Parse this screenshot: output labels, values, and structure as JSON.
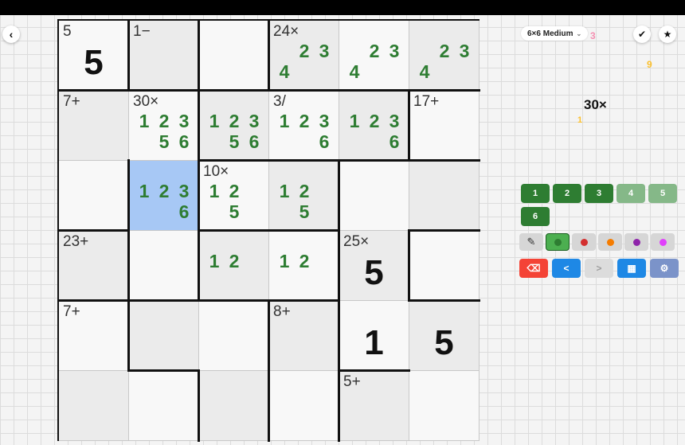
{
  "header": {
    "back_icon": "chevron-left-icon",
    "back_glyph": "‹",
    "difficulty": "6×6 Medium",
    "dropdown_glyph": "⌄",
    "check_glyph": "✔",
    "star_glyph": "★"
  },
  "floating_digits": [
    "3",
    "9",
    "1"
  ],
  "cage_hint": "30×",
  "board": {
    "cells": [
      {
        "cage": "5",
        "value": "5",
        "notes": [],
        "bg": "white"
      },
      {
        "cage": "1−",
        "value": "",
        "notes": [],
        "bg": "shade"
      },
      {
        "cage": "",
        "value": "",
        "notes": [],
        "bg": "white"
      },
      {
        "cage": "24×",
        "value": "",
        "notes": [
          "",
          "2",
          "3",
          "4",
          "",
          ""
        ],
        "bg": "shade"
      },
      {
        "cage": "",
        "value": "",
        "notes": [
          "",
          "2",
          "3",
          "4",
          "",
          ""
        ],
        "bg": "white"
      },
      {
        "cage": "",
        "value": "",
        "notes": [
          "",
          "2",
          "3",
          "4",
          "",
          ""
        ],
        "bg": "shade"
      },
      {
        "cage": "7+",
        "value": "",
        "notes": [],
        "bg": "shade"
      },
      {
        "cage": "30×",
        "value": "",
        "notes": [
          "1",
          "2",
          "3",
          "",
          "5",
          "6"
        ],
        "bg": "white"
      },
      {
        "cage": "",
        "value": "",
        "notes": [
          "1",
          "2",
          "3",
          "",
          "5",
          "6"
        ],
        "bg": "shade"
      },
      {
        "cage": "3/",
        "value": "",
        "notes": [
          "1",
          "2",
          "3",
          "",
          "",
          "6"
        ],
        "bg": "white"
      },
      {
        "cage": "",
        "value": "",
        "notes": [
          "1",
          "2",
          "3",
          "",
          "",
          "6"
        ],
        "bg": "shade"
      },
      {
        "cage": "17+",
        "value": "",
        "notes": [],
        "bg": "white"
      },
      {
        "cage": "",
        "value": "",
        "notes": [],
        "bg": "white"
      },
      {
        "cage": "",
        "value": "",
        "notes": [
          "1",
          "2",
          "3",
          "",
          "",
          "6"
        ],
        "bg": "sel"
      },
      {
        "cage": "10×",
        "value": "",
        "notes": [
          "1",
          "2",
          "",
          "",
          "5",
          ""
        ],
        "bg": "white"
      },
      {
        "cage": "",
        "value": "",
        "notes": [
          "1",
          "2",
          "",
          "",
          "5",
          ""
        ],
        "bg": "shade"
      },
      {
        "cage": "",
        "value": "",
        "notes": [],
        "bg": "white"
      },
      {
        "cage": "",
        "value": "",
        "notes": [],
        "bg": "shade"
      },
      {
        "cage": "23+",
        "value": "",
        "notes": [],
        "bg": "shade"
      },
      {
        "cage": "",
        "value": "",
        "notes": [],
        "bg": "white"
      },
      {
        "cage": "",
        "value": "",
        "notes": [
          "1",
          "2",
          "",
          "",
          "",
          ""
        ],
        "bg": "shade"
      },
      {
        "cage": "",
        "value": "",
        "notes": [
          "1",
          "2",
          "",
          "",
          "",
          ""
        ],
        "bg": "white"
      },
      {
        "cage": "25×",
        "value": "5",
        "notes": [],
        "bg": "shade"
      },
      {
        "cage": "",
        "value": "",
        "notes": [],
        "bg": "white"
      },
      {
        "cage": "7+",
        "value": "",
        "notes": [],
        "bg": "white"
      },
      {
        "cage": "",
        "value": "",
        "notes": [],
        "bg": "shade"
      },
      {
        "cage": "",
        "value": "",
        "notes": [],
        "bg": "white"
      },
      {
        "cage": "8+",
        "value": "",
        "notes": [],
        "bg": "shade"
      },
      {
        "cage": "",
        "value": "1",
        "notes": [],
        "bg": "white"
      },
      {
        "cage": "",
        "value": "5",
        "notes": [],
        "bg": "shade"
      },
      {
        "cage": "",
        "value": "",
        "notes": [],
        "bg": "shade"
      },
      {
        "cage": "",
        "value": "",
        "notes": [],
        "bg": "white"
      },
      {
        "cage": "",
        "value": "",
        "notes": [],
        "bg": "shade"
      },
      {
        "cage": "",
        "value": "",
        "notes": [],
        "bg": "white"
      },
      {
        "cage": "5+",
        "value": "",
        "notes": [],
        "bg": "shade"
      },
      {
        "cage": "",
        "value": "",
        "notes": [],
        "bg": "white"
      }
    ]
  },
  "number_pad": [
    {
      "label": "1",
      "enabled": true
    },
    {
      "label": "2",
      "enabled": true
    },
    {
      "label": "3",
      "enabled": true
    },
    {
      "label": "4",
      "enabled": false
    },
    {
      "label": "5",
      "enabled": false
    },
    {
      "label": "6",
      "enabled": true
    }
  ],
  "tools": [
    {
      "name": "pencil-icon",
      "glyph": "✎"
    },
    {
      "name": "green-color-dot",
      "color": "#2e7d32"
    },
    {
      "name": "red-color-dot",
      "color": "#d32f2f"
    },
    {
      "name": "orange-color-dot",
      "color": "#f57c00"
    },
    {
      "name": "purple-color-dot",
      "color": "#8e24aa"
    },
    {
      "name": "pink-color-dot",
      "color": "#e040fb"
    }
  ],
  "actions": [
    {
      "name": "erase-button",
      "glyph": "⌫",
      "bg": "#f44336",
      "color": "#ffffff"
    },
    {
      "name": "undo-button",
      "glyph": "<",
      "bg": "#1e88e5",
      "color": "#ffffff"
    },
    {
      "name": "redo-button",
      "glyph": ">",
      "bg": "#dcdcdc",
      "color": "#9e9e9e"
    },
    {
      "name": "calculator-button",
      "glyph": "▦",
      "bg": "#1e88e5",
      "color": "#ffffff"
    },
    {
      "name": "settings-button",
      "glyph": "⚙",
      "bg": "#7b93c9",
      "color": "#ffffff"
    }
  ]
}
